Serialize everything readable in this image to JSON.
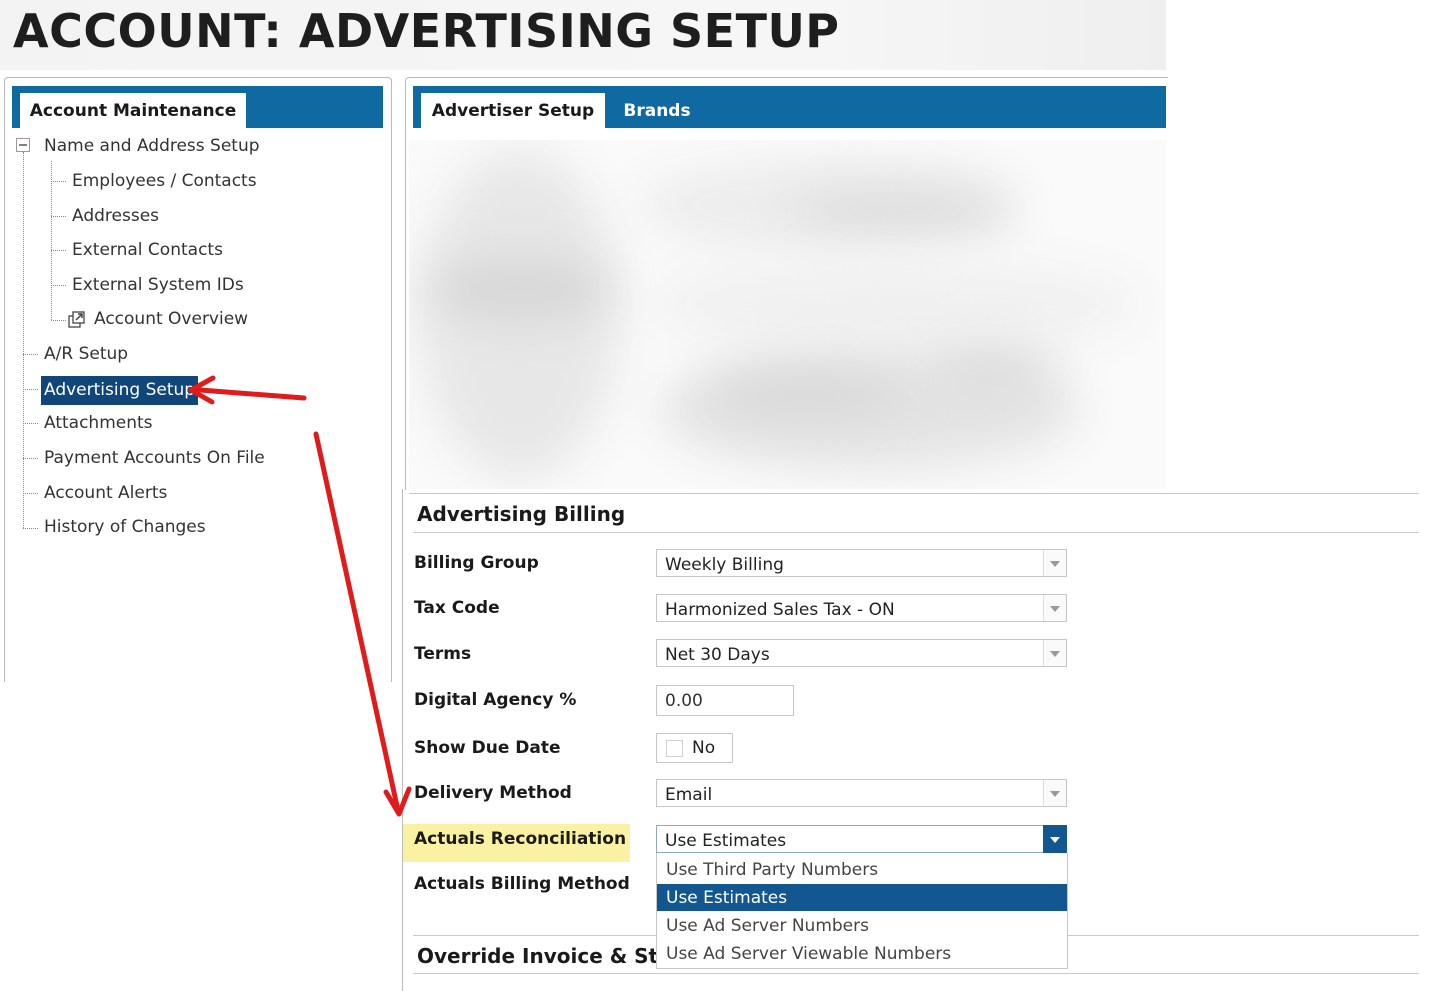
{
  "page": {
    "title": "ACCOUNT: ADVERTISING SETUP"
  },
  "left_panel": {
    "tab_label": "Account Maintenance",
    "tree": {
      "root": "Name and Address Setup",
      "children": [
        "Employees / Contacts",
        "Addresses",
        "External Contacts",
        "External System IDs",
        "Account Overview"
      ],
      "items": [
        "A/R Setup",
        "Advertising Setup",
        "Attachments",
        "Payment Accounts On File",
        "Account Alerts",
        "History of Changes"
      ],
      "selected": "Advertising Setup"
    }
  },
  "right_panel": {
    "tabs": [
      {
        "label": "Advertiser Setup",
        "active": true
      },
      {
        "label": "Brands",
        "active": false
      }
    ]
  },
  "advertising_billing": {
    "section_title": "Advertising Billing",
    "billing_group": {
      "label": "Billing Group",
      "value": "Weekly Billing"
    },
    "tax_code": {
      "label": "Tax Code",
      "value": "Harmonized Sales Tax - ON"
    },
    "terms": {
      "label": "Terms",
      "value": "Net 30 Days"
    },
    "digital_agency": {
      "label": "Digital Agency %",
      "value": "0.00"
    },
    "show_due_date": {
      "label": "Show Due Date",
      "value": "No",
      "checked": false
    },
    "delivery_method": {
      "label": "Delivery Method",
      "value": "Email"
    },
    "actuals_reconciliation": {
      "label": "Actuals Reconciliation",
      "value": "Use Estimates",
      "options": [
        "Use Third Party Numbers",
        "Use Estimates",
        "Use Ad Server Numbers",
        "Use Ad Server Viewable Numbers"
      ],
      "selected_option": "Use Estimates"
    },
    "actuals_billing_method": {
      "label": "Actuals Billing Method"
    }
  },
  "override_section": {
    "title": "Override Invoice & Stater"
  },
  "colors": {
    "tab_bar": "#0f6aa1",
    "selected_item": "#10467a",
    "dropdown_selected": "#12578f",
    "highlight": "#fbf1a2",
    "annotation_arrow": "#e01b1b"
  },
  "icons": [
    "tree-collapse-icon",
    "external-link-icon",
    "chevron-down-icon",
    "red-annotation-arrow"
  ]
}
